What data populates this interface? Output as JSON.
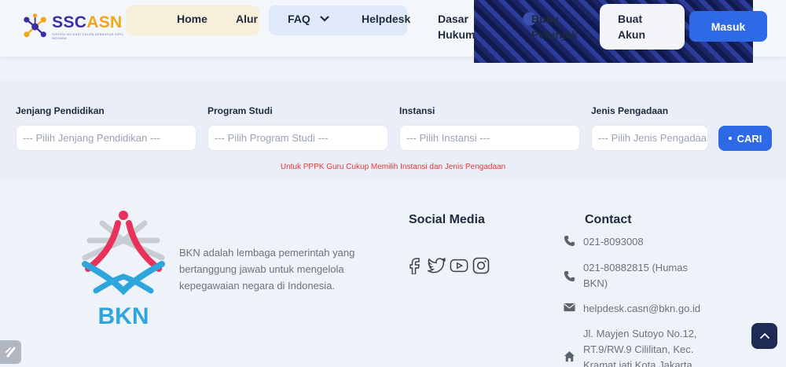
{
  "header": {
    "logo_text_ss": "SSC",
    "logo_text_cn": "ASN",
    "logo_tagline": "SISTEM SELEKSI CALON APARATUR SIPIL NEGARA",
    "nav": {
      "home": "Home",
      "alur": "Alur",
      "faq": "FAQ",
      "helpdesk": "Helpdesk",
      "dasar_hukum": "Dasar Hukum",
      "buku_petunjuk": "Buku Petunjuk"
    },
    "buat_akun": "Buat Akun",
    "masuk": "Masuk"
  },
  "search": {
    "fields": [
      {
        "label": "Jenjang Pendidikan",
        "placeholder": "--- Pilih Jenjang Pendidikan ---"
      },
      {
        "label": "Program Studi",
        "placeholder": "--- Pilih Program Studi ---"
      },
      {
        "label": "Instansi",
        "placeholder": "--- Pilih Instansi ---"
      },
      {
        "label": "Jenis Pengadaan",
        "placeholder": "--- Pilih Jenis Pengadaa"
      }
    ],
    "button": "CARI",
    "notice": "Untuk PPPK Guru Cukup Memilih Instansi dan Jenis Pengadaan"
  },
  "footer": {
    "bkn_logo_text": "BKN",
    "description": "BKN adalah lembaga pemerintah yang bertanggung jawab untuk mengelola kepegawaian negara di Indonesia.",
    "social_title": "Social Media",
    "social_icons": [
      "facebook-icon",
      "twitter-icon",
      "youtube-icon",
      "instagram-icon"
    ],
    "contact_title": "Contact",
    "contacts": [
      {
        "icon": "phone-icon",
        "text": "021-8093008"
      },
      {
        "icon": "phone-icon",
        "text": "021-80882815 (Humas BKN)"
      },
      {
        "icon": "mail-icon",
        "text": "helpdesk.casn@bkn.go.id"
      },
      {
        "icon": "home-icon",
        "text": "Jl. Mayjen Sutoyo No.12, RT.9/RW.9 Cililitan, Kec. Kramat jati Kota Jakarta"
      }
    ]
  },
  "colors": {
    "primary": "#2f6ae6",
    "notice": "#e53935",
    "logo_purple": "#3d2ca3",
    "logo_orange": "#f2a71b"
  }
}
